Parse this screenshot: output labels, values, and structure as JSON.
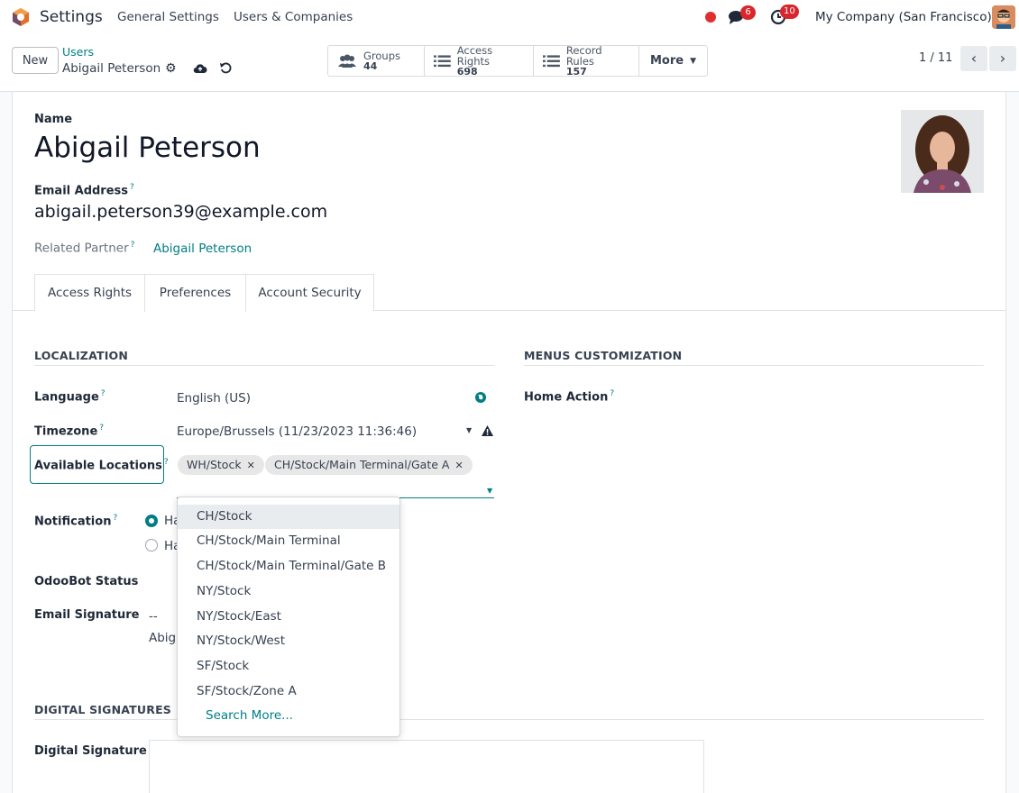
{
  "navbar": {
    "app_name": "Settings",
    "menus": [
      "General Settings",
      "Users & Companies"
    ],
    "messages_count": "6",
    "activities_count": "10",
    "company": "My Company (San Francisco)"
  },
  "control_panel": {
    "new_label": "New",
    "breadcrumb_parent": "Users",
    "breadcrumb_current": "Abigail Peterson",
    "smart_buttons": [
      {
        "label": "Groups",
        "value": "44",
        "icon": "users-icon"
      },
      {
        "label": "Access Rights",
        "value": "698",
        "icon": "list-icon"
      },
      {
        "label": "Record Rules",
        "value": "157",
        "icon": "list-icon"
      }
    ],
    "more_label": "More",
    "pager": "1 / 11"
  },
  "form": {
    "name_label": "Name",
    "name_value": "Abigail Peterson",
    "email_label": "Email Address",
    "email_value": "abigail.peterson39@example.com",
    "partner_label": "Related Partner",
    "partner_value": "Abigail Peterson",
    "help_mark": "?"
  },
  "tabs": [
    {
      "label": "Access Rights",
      "active": false
    },
    {
      "label": "Preferences",
      "active": true
    },
    {
      "label": "Account Security",
      "active": false
    }
  ],
  "localization": {
    "title": "LOCALIZATION",
    "language_label": "Language",
    "language_value": "English (US)",
    "timezone_label": "Timezone",
    "timezone_value": "Europe/Brussels (11/23/2023 11:36:46)",
    "locations_label": "Available Locations",
    "location_tags": [
      "WH/Stock",
      "CH/Stock/Main Terminal/Gate A"
    ],
    "notification_label": "Notification",
    "notification_options": [
      "Ha",
      "Ha"
    ],
    "odoobot_label": "OdooBot Status",
    "signature_label": "Email Signature",
    "signature_dash": "--",
    "signature_name": "Abiga"
  },
  "menus_customization": {
    "title": "MENUS CUSTOMIZATION",
    "home_action_label": "Home Action"
  },
  "digital": {
    "title": "DIGITAL SIGNATURES",
    "signature_label": "Digital Signature"
  },
  "dropdown": {
    "items": [
      "CH/Stock",
      "CH/Stock/Main Terminal",
      "CH/Stock/Main Terminal/Gate B",
      "NY/Stock",
      "NY/Stock/East",
      "NY/Stock/West",
      "SF/Stock",
      "SF/Stock/Zone A"
    ],
    "search_more": "Search More..."
  },
  "colors": {
    "accent": "#017e84",
    "badge": "#d9262d",
    "brand": "#714b67"
  }
}
